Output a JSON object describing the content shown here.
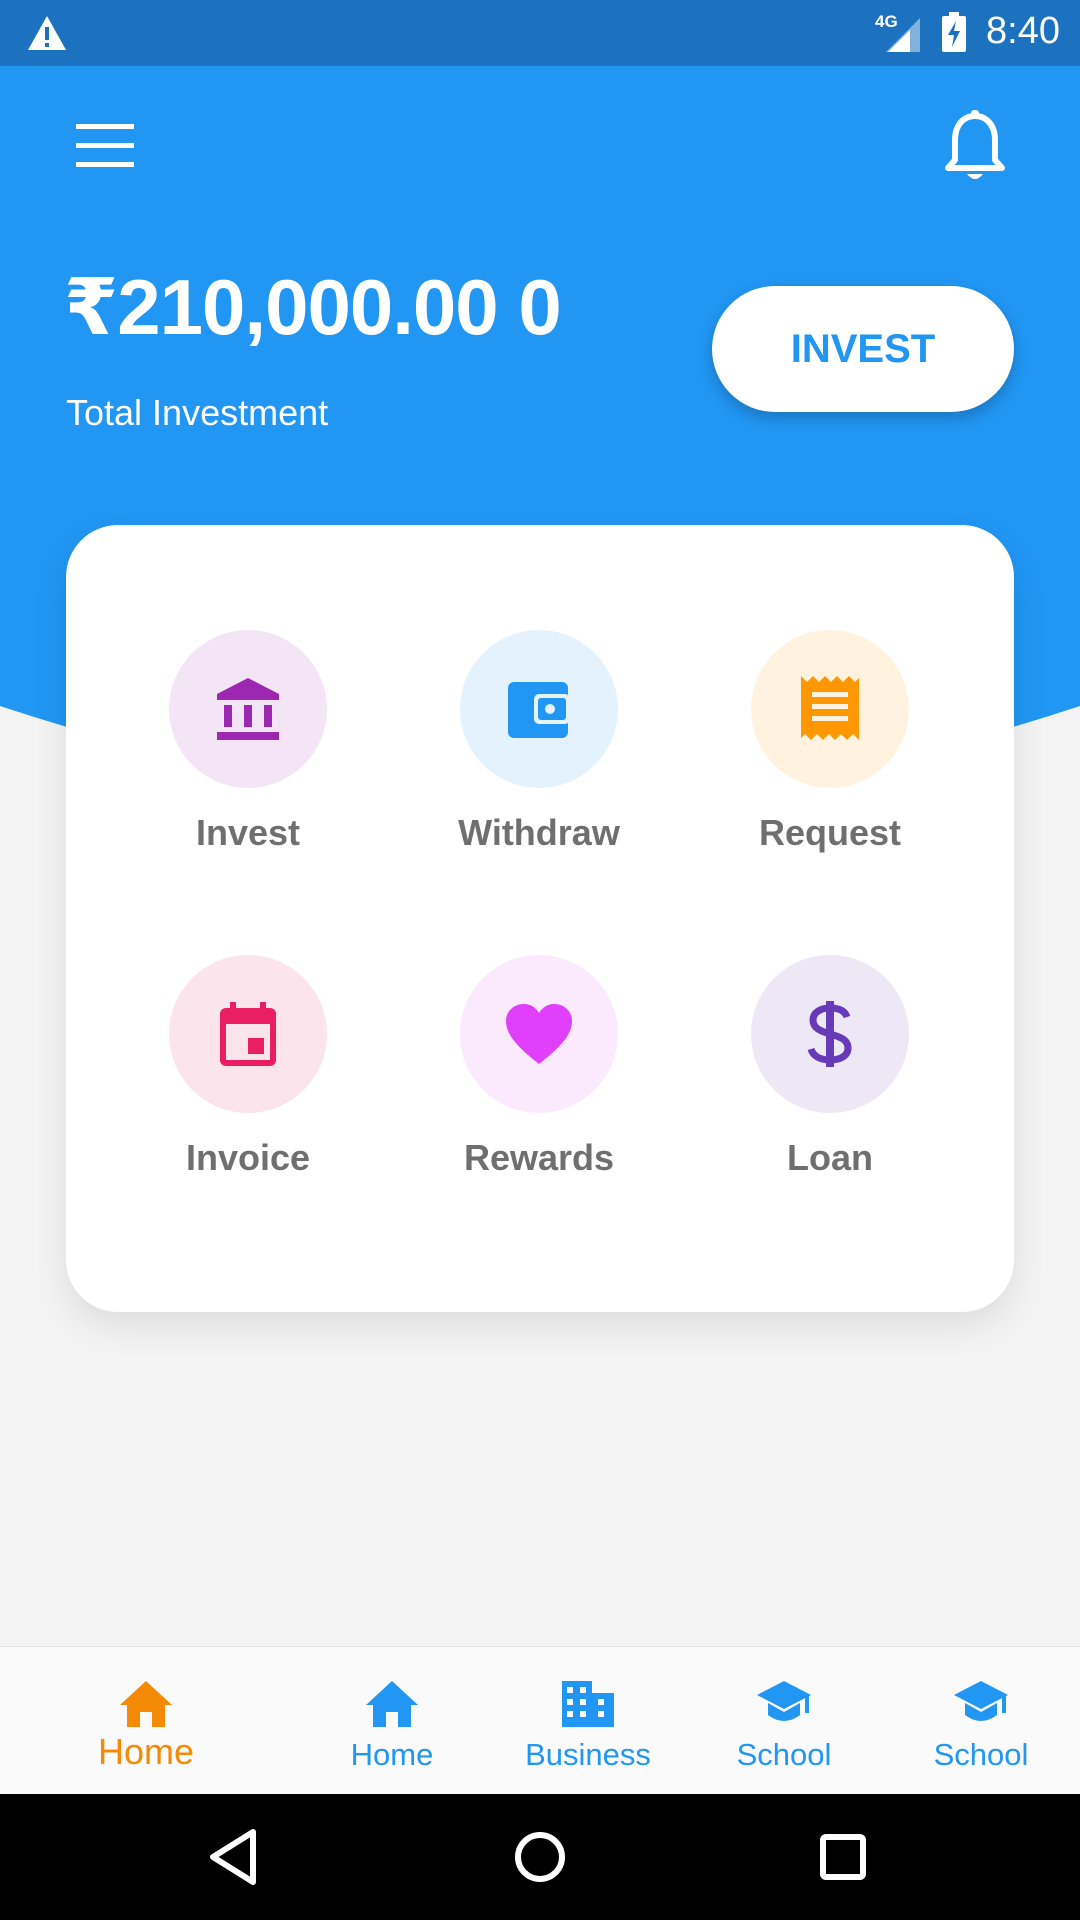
{
  "status_bar": {
    "network": "4G",
    "time": "8:40"
  },
  "header": {
    "total_amount": "₹210,000.00 0",
    "total_label": "Total Investment",
    "invest_button": "INVEST"
  },
  "actions": [
    {
      "label": "Invest",
      "icon": "bank-icon",
      "color": "#9c27b0",
      "bg": "#f3e5f5"
    },
    {
      "label": "Withdraw",
      "icon": "wallet-icon",
      "color": "#2196f3",
      "bg": "#e3f2fd"
    },
    {
      "label": "Request",
      "icon": "receipt-icon",
      "color": "#ff9800",
      "bg": "#fff3e0"
    },
    {
      "label": "Invoice",
      "icon": "calendar-icon",
      "color": "#e91e63",
      "bg": "#fce4ec"
    },
    {
      "label": "Rewards",
      "icon": "heart-icon",
      "color": "#e040fb",
      "bg": "#fbe9fd"
    },
    {
      "label": "Loan",
      "icon": "dollar-icon",
      "color": "#673ab7",
      "bg": "#ede7f6"
    }
  ],
  "bottom_nav": [
    {
      "label": "Home",
      "icon": "home-icon",
      "active": true
    },
    {
      "label": "Home",
      "icon": "home-icon",
      "active": false
    },
    {
      "label": "Business",
      "icon": "business-icon",
      "active": false
    },
    {
      "label": "School",
      "icon": "school-icon",
      "active": false
    },
    {
      "label": "School",
      "icon": "school-icon",
      "active": false
    }
  ],
  "colors": {
    "primary": "#2196f3",
    "status_bar": "#1c72bf",
    "active_nav": "#f58a07",
    "label_gray": "#6f6f6f"
  }
}
